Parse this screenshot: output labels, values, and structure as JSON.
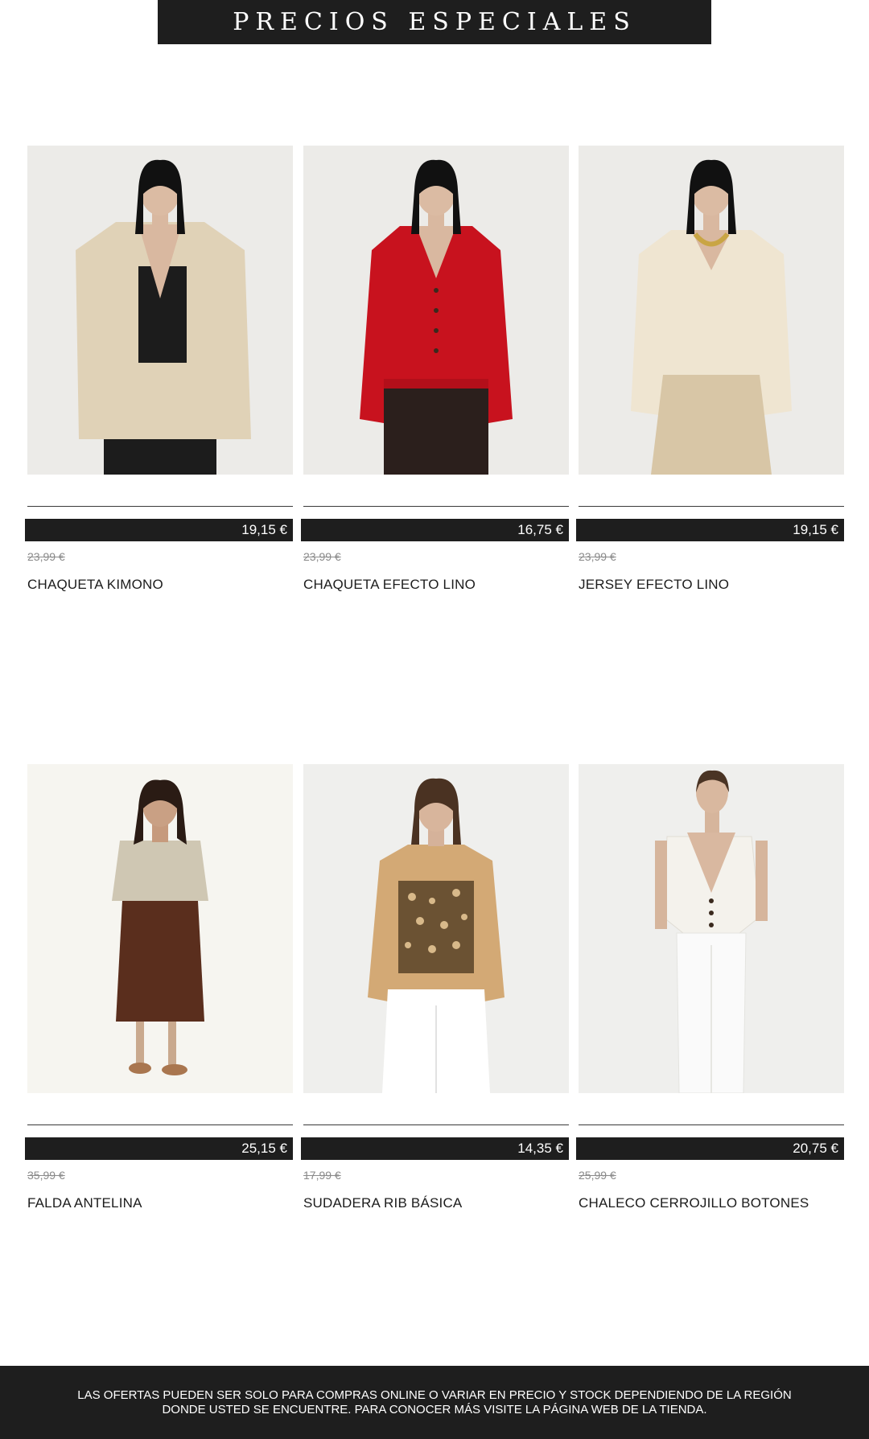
{
  "header": {
    "title": "PRECIOS ESPECIALES"
  },
  "products": [
    {
      "name": "CHAQUETA KIMONO",
      "price": "19,15 €",
      "old_price": "23,99 €"
    },
    {
      "name": "CHAQUETA EFECTO LINO",
      "price": "16,75 €",
      "old_price": "23,99 €"
    },
    {
      "name": "JERSEY EFECTO LINO",
      "price": "19,15 €",
      "old_price": "23,99 €"
    },
    {
      "name": "FALDA ANTELINA",
      "price": "25,15 €",
      "old_price": "35,99 €"
    },
    {
      "name": "SUDADERA RIB BÁSICA",
      "price": "14,35 €",
      "old_price": "17,99 €"
    },
    {
      "name": "CHALECO CERROJILLO BOTONES",
      "price": "20,75 €",
      "old_price": "25,99 €"
    }
  ],
  "footer": {
    "line1": "LAS OFERTAS PUEDEN SER SOLO PARA COMPRAS ONLINE O VARIAR EN PRECIO Y STOCK DEPENDIENDO DE LA REGIÓN",
    "line2": "DONDE USTED SE ENCUENTRE. PARA CONOCER MÁS VISITE LA PÁGINA WEB DE LA TIENDA."
  },
  "colors": {
    "dark": "#1e1e1e",
    "text": "#1c1c1c",
    "muted": "#8a8a8a",
    "background": "#ffffff"
  }
}
